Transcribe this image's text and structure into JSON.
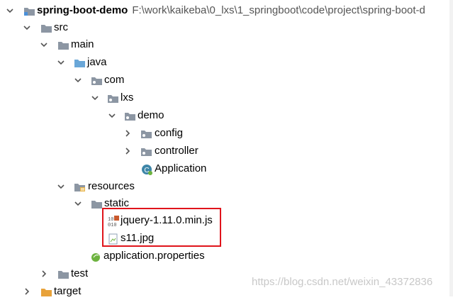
{
  "tree": {
    "project": {
      "name": "spring-boot-demo",
      "path": "F:\\work\\kaikeba\\0_lxs\\1_springboot\\code\\project\\spring-boot-d"
    },
    "src": "src",
    "main": "main",
    "java": "java",
    "com": "com",
    "lxs": "lxs",
    "demo": "demo",
    "config": "config",
    "controller": "controller",
    "application_class": "Application",
    "resources": "resources",
    "static": "static",
    "jquery_file": "jquery-1.11.0.min.js",
    "image_file": "s11.jpg",
    "properties_file": "application.properties",
    "test": "test",
    "target": "target"
  },
  "watermark": "https://blog.csdn.net/weixin_43372836",
  "colors": {
    "folder": "#8c96a3",
    "source_folder": "#6aa7d8",
    "highlight_border": "#e0141b"
  }
}
